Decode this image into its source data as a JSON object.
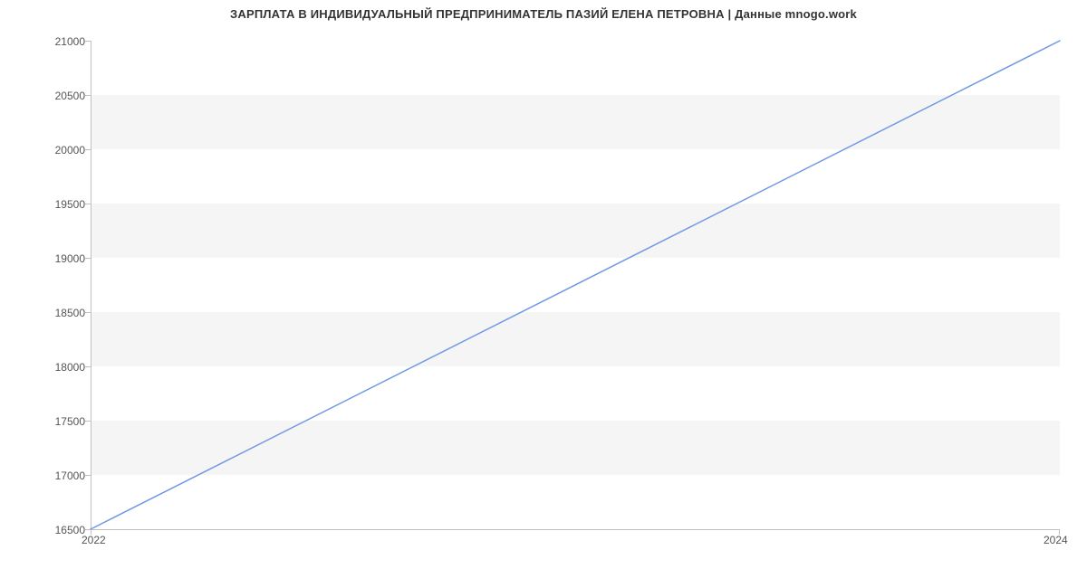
{
  "chart_data": {
    "type": "line",
    "title": "ЗАРПЛАТА В ИНДИВИДУАЛЬНЫЙ ПРЕДПРИНИМАТЕЛЬ ПАЗИЙ ЕЛЕНА ПЕТРОВНА | Данные mnogo.work",
    "x": [
      2022,
      2024
    ],
    "values": [
      16500,
      21000
    ],
    "xlabel": "",
    "ylabel": "",
    "x_ticks": [
      2022,
      2024
    ],
    "y_ticks": [
      16500,
      17000,
      17500,
      18000,
      18500,
      19000,
      19500,
      20000,
      20500,
      21000
    ],
    "xlim": [
      2022,
      2024
    ],
    "ylim": [
      16500,
      21000
    ],
    "line_color": "#6f9ae3",
    "band_color": "#f5f5f5",
    "axis_color": "#bfbfbf"
  }
}
